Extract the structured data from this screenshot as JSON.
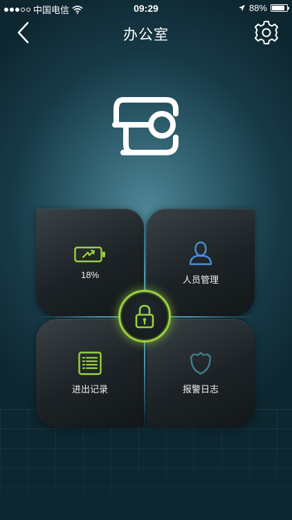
{
  "status_bar": {
    "carrier": "中国电信",
    "time": "09:29",
    "battery_text": "88%",
    "battery_level": 0.88,
    "signal_bars_filled": 3,
    "signal_bars_total": 5,
    "icons": [
      "wifi-icon",
      "location-arrow-icon",
      "battery-icon"
    ]
  },
  "nav": {
    "title": "办公室",
    "back_icon": "chevron-left-icon",
    "settings_icon": "gear-icon"
  },
  "logo_icon": "key-logo-icon",
  "tiles": {
    "battery": {
      "label": "18%",
      "icon": "battery-charging-icon",
      "level": 0.18
    },
    "personnel": {
      "label": "人员管理",
      "icon": "person-icon"
    },
    "access_log": {
      "label": "进出记录",
      "icon": "list-document-icon"
    },
    "alarm_log": {
      "label": "报警日志",
      "icon": "shield-badge-icon"
    }
  },
  "lock_button": {
    "icon": "padlock-icon"
  },
  "colors": {
    "accent_green": "#9bd23c",
    "person_blue": "#4a90d9",
    "shield_teal": "#3f7f8c",
    "background_center": "#4d8596",
    "background_edge": "#0d2630"
  }
}
